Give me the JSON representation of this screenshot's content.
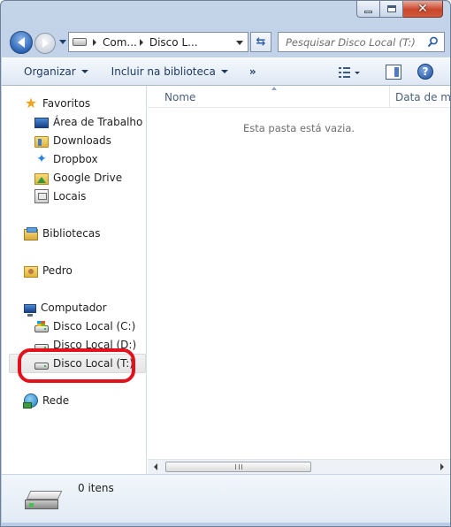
{
  "window": {
    "caption": {
      "close_glyph": "✕"
    }
  },
  "navigation": {
    "address_crumbs": [
      "Com...",
      "Disco L..."
    ],
    "search_placeholder": "Pesquisar Disco Local (T:)"
  },
  "toolbar": {
    "organize_label": "Organizar",
    "include_library_label": "Incluir na biblioteca",
    "more_label": "»",
    "help_label": "?"
  },
  "sidebar": {
    "favorites": {
      "label": "Favoritos",
      "items": [
        {
          "label": "Área de Trabalho",
          "icon": "desktop-icon"
        },
        {
          "label": "Downloads",
          "icon": "downloads-folder-icon"
        },
        {
          "label": "Dropbox",
          "icon": "dropbox-icon"
        },
        {
          "label": "Google Drive",
          "icon": "google-drive-icon"
        },
        {
          "label": "Locais",
          "icon": "recent-places-icon"
        }
      ]
    },
    "libraries": {
      "label": "Bibliotecas"
    },
    "user": {
      "label": "Pedro"
    },
    "computer": {
      "label": "Computador",
      "items": [
        {
          "label": "Disco Local (C:)"
        },
        {
          "label": "Disco Local (D:)"
        },
        {
          "label": "Disco Local (T:)",
          "selected": true
        }
      ]
    },
    "network": {
      "label": "Rede"
    }
  },
  "file_list": {
    "columns": [
      "Nome",
      "Data de m"
    ],
    "empty_message": "Esta pasta está vazia."
  },
  "details_pane": {
    "item_count": "0 itens"
  },
  "colors": {
    "highlight_ring": "#e2111b",
    "window_frame": "#b9cce5"
  }
}
